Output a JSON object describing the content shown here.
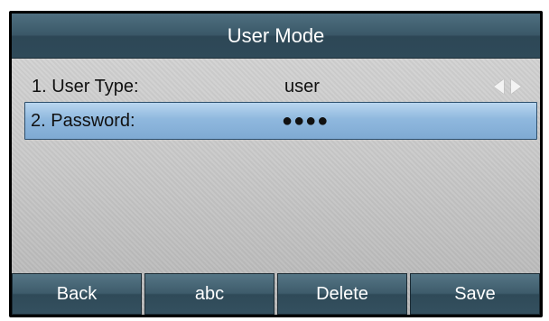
{
  "header": {
    "title": "User Mode"
  },
  "rows": [
    {
      "label": "1. User Type:",
      "value": "user",
      "icons": [
        "left-arrow-icon",
        "right-arrow-icon"
      ]
    },
    {
      "label": "2. Password:",
      "value": "●●●●",
      "selected": true
    }
  ],
  "softkeys": [
    "Back",
    "abc",
    "Delete",
    "Save"
  ],
  "colors": {
    "title_bar": "#3a5868",
    "highlight": "#8fb8de",
    "softkey": "#3e5c6b",
    "background": "#cbcbcb"
  }
}
